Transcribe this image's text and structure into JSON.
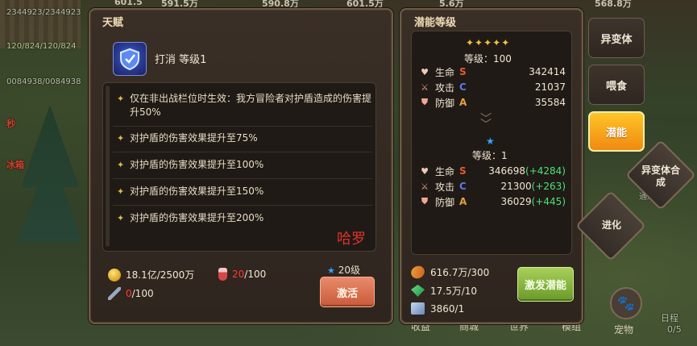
{
  "background": {
    "top_numbers": [
      "601.5",
      "591.5万",
      "590.8万",
      "601.5万",
      "5.6万",
      "568.8万"
    ],
    "left_stats": [
      "2344923/2344923",
      "120/824/120/824",
      "0084938/0084938"
    ],
    "left_red": [
      "秒",
      "冰箱"
    ],
    "right_texts": [
      "通过来了",
      "日程",
      "0/5"
    ],
    "bottom_tabs": [
      "收益",
      "商城",
      "世界",
      "模组",
      "宠物"
    ]
  },
  "talent": {
    "title": "天赋",
    "skill_name": "打消 等级1",
    "effects": [
      "仅在非出战栏位时生效：我方冒险者对护盾造成的伤害提升50%",
      "对护盾的伤害效果提升至75%",
      "对护盾的伤害效果提升至100%",
      "对护盾的伤害效果提升至150%",
      "对护盾的伤害效果提升至200%"
    ],
    "watermark": "哈罗",
    "resources": {
      "gold": "18.1亿/2500万",
      "potion_have": "20",
      "potion_need": "/100",
      "wrench_have": "0",
      "wrench_need": "/100"
    },
    "level_req": "20级",
    "activate_label": "激活"
  },
  "potential": {
    "title": "潜能等级",
    "stars": "✦✦✦✦✦",
    "top_level": "等级：100",
    "top_stats": [
      {
        "name": "生命",
        "grade": "S",
        "value": "342414"
      },
      {
        "name": "攻击",
        "grade": "C",
        "value": "21037"
      },
      {
        "name": "防御",
        "grade": "A",
        "value": "35584"
      }
    ],
    "bottom_level": "等级：1",
    "bottom_stats": [
      {
        "name": "生命",
        "grade": "S",
        "value": "346698",
        "bonus": "(+4284)"
      },
      {
        "name": "攻击",
        "grade": "C",
        "value": "21300",
        "bonus": "(+263)"
      },
      {
        "name": "防御",
        "grade": "A",
        "value": "36029",
        "bonus": "(+445)"
      }
    ],
    "costs": [
      "616.7万/300",
      "17.5万/10",
      "3860/1"
    ],
    "button_label": "激发潜能"
  },
  "side_tabs": [
    "异变体",
    "喂食",
    "潜能"
  ],
  "side_diamonds": [
    "异变体合成",
    "进化"
  ]
}
